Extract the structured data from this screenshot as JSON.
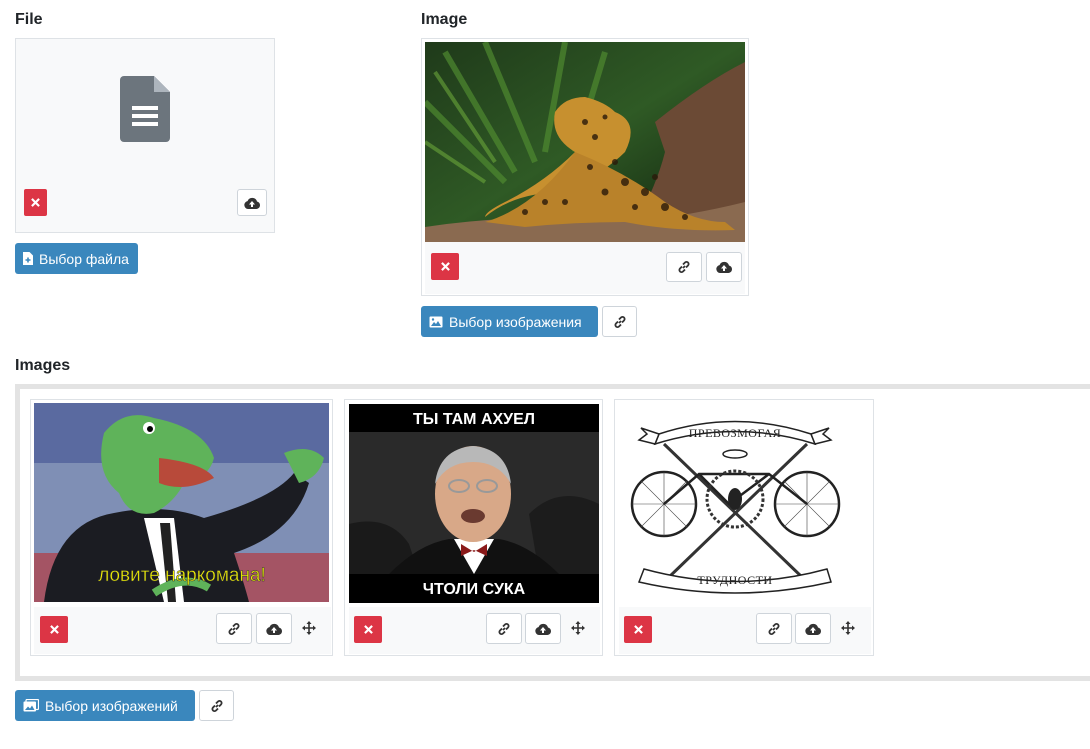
{
  "file_field": {
    "label": "File",
    "select_button": "Выбор файла",
    "icons": {
      "preview": "file-document-icon",
      "delete": "close-icon",
      "upload": "cloud-upload-icon",
      "select": "file-add-icon"
    }
  },
  "image_field": {
    "label": "Image",
    "select_button": "Выбор изображения",
    "preview_alt": "jaguar",
    "icons": {
      "delete": "close-icon",
      "link": "link-icon",
      "upload": "cloud-upload-icon",
      "select": "image-icon"
    }
  },
  "images_field": {
    "label": "Images",
    "select_button": "Выбор изображений",
    "items": [
      {
        "caption": "ловите наркомана!"
      },
      {
        "caption_top": "ТЫ ТАМ АХУЕЛ",
        "caption_bottom": "ЧТОЛИ СУКА"
      },
      {
        "banner_top": "ПРЕВОЗМОГАЯ",
        "banner_bottom": "ТРУДНОСТИ"
      }
    ],
    "icons": {
      "delete": "close-icon",
      "link": "link-icon",
      "upload": "cloud-upload-icon",
      "move": "move-arrows-icon",
      "select": "images-icon"
    }
  },
  "colors": {
    "primary": "#3a87bd",
    "danger": "#dc3545",
    "border": "#dee2e6",
    "footer_bg": "#f8f9fa"
  }
}
